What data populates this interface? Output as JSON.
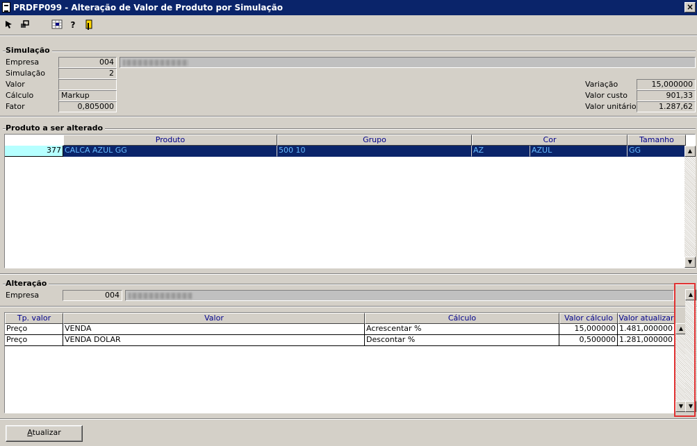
{
  "window": {
    "title": "PRDFP099 - Alteração de Valor de Produto por Simulação",
    "close_label": "×"
  },
  "toolbar": {
    "icons": [
      "cursor-icon",
      "reload-icon",
      "grid-icon",
      "help-icon",
      "exit-icon"
    ],
    "help_glyph": "?"
  },
  "simulacao": {
    "title": "Simulação",
    "empresa_label": "Empresa",
    "empresa_value": "004",
    "simulacao_label": "Simulação",
    "simulacao_value": "2",
    "valor_label": "Valor",
    "valor_value": "",
    "calculo_label": "Cálculo",
    "calculo_value": "Markup",
    "fator_label": "Fator",
    "fator_value": "0,805000",
    "variacao_label": "Variação",
    "variacao_value": "15,000000",
    "valor_custo_label": "Valor custo",
    "valor_custo_value": "901,33",
    "valor_unitario_label": "Valor unitário",
    "valor_unitario_value": "1.287,62"
  },
  "produto": {
    "title": "Produto a ser alterado",
    "columns": [
      "Produto",
      "Grupo",
      "Cor",
      "Tamanho"
    ],
    "rows": [
      {
        "codigo": "377",
        "produto": "CALCA AZUL GG",
        "grupo": "500 10",
        "cor_cod": "AZ",
        "cor": "AZUL",
        "tamanho": "GG"
      }
    ]
  },
  "alteracao": {
    "title": "Alteração",
    "empresa_label": "Empresa",
    "empresa_value": "004",
    "columns": [
      "Tp. valor",
      "Valor",
      "Cálculo",
      "Valor cálculo",
      "Valor atualizar"
    ],
    "rows": [
      {
        "tp_valor": "Preço",
        "valor": "VENDA",
        "calculo": "Acrescentar %",
        "valor_calculo": "15,000000",
        "valor_atualizar": "1.481,000000"
      },
      {
        "tp_valor": "Preço",
        "valor": "VENDA DOLAR",
        "calculo": "Descontar %",
        "valor_calculo": "0,500000",
        "valor_atualizar": "1.281,000000"
      }
    ]
  },
  "footer": {
    "atualizar_label": "Atualizar"
  },
  "colors": {
    "titlebar": "#0a246a",
    "selection": "#0a246a",
    "highlight_box": "#e03030",
    "header_text": "#00008b"
  }
}
